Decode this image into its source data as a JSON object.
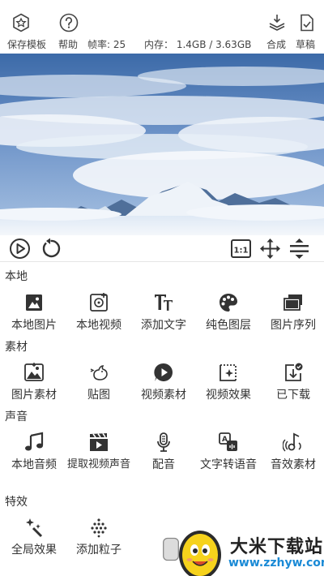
{
  "topbar": {
    "save_template": "保存模板",
    "help": "帮助",
    "frame_rate": "帧率: 25",
    "memory": "内存： 1.4GB / 3.63GB",
    "compose": "合成",
    "draft": "草稿"
  },
  "sections": [
    {
      "title": "本地",
      "items": [
        {
          "label": "本地图片",
          "icon": "image-icon"
        },
        {
          "label": "本地视频",
          "icon": "video-add-icon"
        },
        {
          "label": "添加文字",
          "icon": "text-icon"
        },
        {
          "label": "纯色图层",
          "icon": "palette-icon"
        },
        {
          "label": "图片序列",
          "icon": "image-sequence-icon"
        }
      ]
    },
    {
      "title": "素材",
      "items": [
        {
          "label": "图片素材",
          "icon": "photo-material-icon"
        },
        {
          "label": "贴图",
          "icon": "sticker-icon"
        },
        {
          "label": "视频素材",
          "icon": "video-material-icon"
        },
        {
          "label": "视频效果",
          "icon": "video-effect-icon"
        },
        {
          "label": "已下载",
          "icon": "downloaded-icon"
        }
      ]
    },
    {
      "title": "声音",
      "items": [
        {
          "label": "本地音频",
          "icon": "music-note-icon"
        },
        {
          "label": "提取视频声音",
          "icon": "clapper-icon"
        },
        {
          "label": "配音",
          "icon": "microphone-icon"
        },
        {
          "label": "文字转语音",
          "icon": "text-to-speech-icon"
        },
        {
          "label": "音效素材",
          "icon": "sound-effect-icon"
        }
      ]
    },
    {
      "title": "特效",
      "items": [
        {
          "label": "全局效果",
          "icon": "sparkle-wand-icon"
        },
        {
          "label": "添加粒子",
          "icon": "particles-icon"
        }
      ]
    }
  ],
  "watermark": {
    "text": "大米下载站",
    "url": "www.zzhyw.com"
  }
}
